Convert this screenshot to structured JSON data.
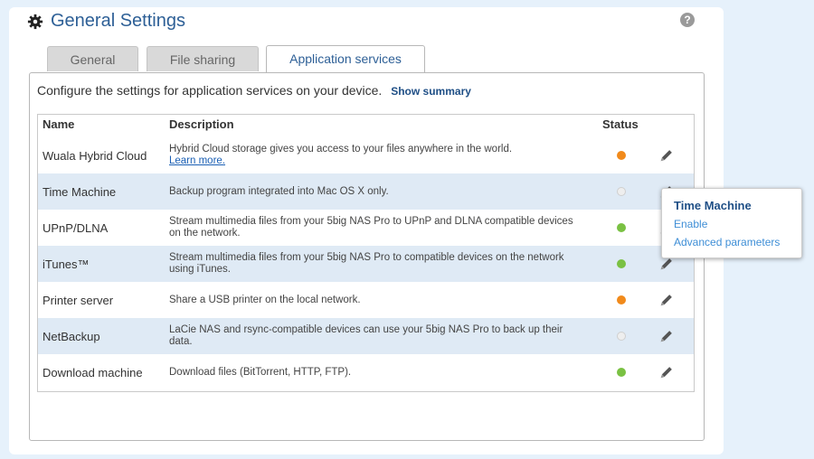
{
  "header": {
    "title": "General Settings",
    "help_icon": "?"
  },
  "tabs": [
    {
      "label": "General"
    },
    {
      "label": "File sharing"
    },
    {
      "label": "Application services",
      "active": true
    }
  ],
  "intro": {
    "text": "Configure the settings for application services on your device.",
    "link": "Show summary"
  },
  "table": {
    "headers": {
      "name": "Name",
      "description": "Description",
      "status": "Status"
    },
    "rows": [
      {
        "name": "Wuala Hybrid Cloud",
        "description": "Hybrid Cloud storage gives you access to your files anywhere in the world.",
        "link": "Learn more.",
        "status": "orange"
      },
      {
        "name": "Time Machine",
        "description": "Backup program integrated into Mac OS X only.",
        "status": "grey"
      },
      {
        "name": "UPnP/DLNA",
        "description": "Stream multimedia files from your 5big NAS Pro to UPnP and DLNA compatible devices on the network.",
        "status": "green"
      },
      {
        "name": "iTunes™",
        "description": "Stream multimedia files from your 5big NAS Pro to compatible devices on the network using iTunes.",
        "status": "green"
      },
      {
        "name": "Printer server",
        "description": "Share a USB printer on the local network.",
        "status": "orange"
      },
      {
        "name": "NetBackup",
        "description": "LaCie NAS and rsync-compatible devices can use your 5big NAS Pro to back up their data.",
        "status": "grey"
      },
      {
        "name": "Download machine",
        "description": "Download files (BitTorrent, HTTP, FTP).",
        "status": "green"
      }
    ]
  },
  "popup": {
    "title": "Time Machine",
    "items": [
      "Enable",
      "Advanced parameters"
    ]
  },
  "colors": {
    "accent": "#2d5f96",
    "status_orange": "#f18a1b",
    "status_green": "#7ac143",
    "status_grey": "#eeeeee",
    "row_alt": "#dfeaf5"
  },
  "icons": {
    "title": "gear-icon",
    "help": "help-icon",
    "edit": "pencil-icon"
  }
}
